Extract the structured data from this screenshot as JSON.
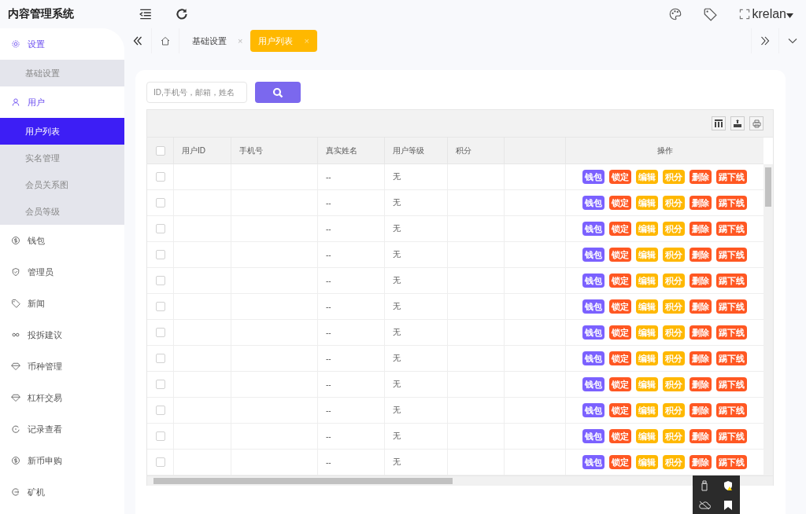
{
  "app": {
    "title": "内容管理系统",
    "user": "krelan"
  },
  "sidebar": {
    "items": [
      {
        "label": "设置",
        "expanded": true,
        "children": [
          {
            "label": "基础设置",
            "selected": false
          }
        ]
      },
      {
        "label": "用户",
        "expanded": true,
        "children": [
          {
            "label": "用户列表",
            "selected": true
          },
          {
            "label": "实名管理",
            "selected": false
          },
          {
            "label": "会员关系图",
            "selected": false
          },
          {
            "label": "会员等级",
            "selected": false
          }
        ]
      },
      {
        "label": "钱包",
        "expanded": false
      },
      {
        "label": "管理员",
        "expanded": false
      },
      {
        "label": "新闻",
        "expanded": false
      },
      {
        "label": "投拆建议",
        "expanded": false
      },
      {
        "label": "币种管理",
        "expanded": false
      },
      {
        "label": "杠杆交易",
        "expanded": false
      },
      {
        "label": "记录查看",
        "expanded": false
      },
      {
        "label": "新币申购",
        "expanded": false
      },
      {
        "label": "矿机",
        "expanded": false
      }
    ]
  },
  "tabs": [
    {
      "label": "基础设置",
      "close": "×",
      "selected": false
    },
    {
      "label": "用户列表",
      "close": "×",
      "selected": true
    }
  ],
  "search": {
    "placeholder": "ID,手机号，邮箱，姓名"
  },
  "table": {
    "select_all_checked": false,
    "columns": [
      "用户ID",
      "手机号",
      "真实姓名",
      "用户等级",
      "积分",
      "",
      "操作"
    ],
    "rows": [
      {
        "checked": false,
        "real_name": "--",
        "level": "无",
        "actions": [
          {
            "label": "钱包",
            "color": "#7b61ff"
          },
          {
            "label": "锁定",
            "color": "#ff5722"
          },
          {
            "label": "编辑",
            "color": "#ffb800"
          },
          {
            "label": "积分",
            "color": "#ffb800"
          },
          {
            "label": "删除",
            "color": "#ff5722"
          },
          {
            "label": "踢下线",
            "color": "#ff5722"
          }
        ]
      },
      {
        "checked": false,
        "real_name": "--",
        "level": "无",
        "actions": [
          {
            "label": "钱包",
            "color": "#7b61ff"
          },
          {
            "label": "锁定",
            "color": "#ff5722"
          },
          {
            "label": "编辑",
            "color": "#ffb800"
          },
          {
            "label": "积分",
            "color": "#ffb800"
          },
          {
            "label": "删除",
            "color": "#ff5722"
          },
          {
            "label": "踢下线",
            "color": "#ff5722"
          }
        ]
      },
      {
        "checked": false,
        "real_name": "--",
        "level": "无",
        "actions": [
          {
            "label": "钱包",
            "color": "#7b61ff"
          },
          {
            "label": "锁定",
            "color": "#ff5722"
          },
          {
            "label": "编辑",
            "color": "#ffb800"
          },
          {
            "label": "积分",
            "color": "#ffb800"
          },
          {
            "label": "删除",
            "color": "#ff5722"
          },
          {
            "label": "踢下线",
            "color": "#ff5722"
          }
        ]
      },
      {
        "checked": false,
        "real_name": "--",
        "level": "无",
        "actions": [
          {
            "label": "钱包",
            "color": "#7b61ff"
          },
          {
            "label": "锁定",
            "color": "#ff5722"
          },
          {
            "label": "编辑",
            "color": "#ffb800"
          },
          {
            "label": "积分",
            "color": "#ffb800"
          },
          {
            "label": "删除",
            "color": "#ff5722"
          },
          {
            "label": "踢下线",
            "color": "#ff5722"
          }
        ]
      },
      {
        "checked": false,
        "real_name": "--",
        "level": "无",
        "actions": [
          {
            "label": "钱包",
            "color": "#7b61ff"
          },
          {
            "label": "锁定",
            "color": "#ff5722"
          },
          {
            "label": "编辑",
            "color": "#ffb800"
          },
          {
            "label": "积分",
            "color": "#ffb800"
          },
          {
            "label": "删除",
            "color": "#ff5722"
          },
          {
            "label": "踢下线",
            "color": "#ff5722"
          }
        ]
      },
      {
        "checked": false,
        "real_name": "--",
        "level": "无",
        "actions": [
          {
            "label": "钱包",
            "color": "#7b61ff"
          },
          {
            "label": "锁定",
            "color": "#ff5722"
          },
          {
            "label": "编辑",
            "color": "#ffb800"
          },
          {
            "label": "积分",
            "color": "#ffb800"
          },
          {
            "label": "删除",
            "color": "#ff5722"
          },
          {
            "label": "踢下线",
            "color": "#ff5722"
          }
        ]
      },
      {
        "checked": false,
        "real_name": "--",
        "level": "无",
        "actions": [
          {
            "label": "钱包",
            "color": "#7b61ff"
          },
          {
            "label": "锁定",
            "color": "#ff5722"
          },
          {
            "label": "编辑",
            "color": "#ffb800"
          },
          {
            "label": "积分",
            "color": "#ffb800"
          },
          {
            "label": "删除",
            "color": "#ff5722"
          },
          {
            "label": "踢下线",
            "color": "#ff5722"
          }
        ]
      },
      {
        "checked": false,
        "real_name": "--",
        "level": "无",
        "actions": [
          {
            "label": "钱包",
            "color": "#7b61ff"
          },
          {
            "label": "锁定",
            "color": "#ff5722"
          },
          {
            "label": "编辑",
            "color": "#ffb800"
          },
          {
            "label": "积分",
            "color": "#ffb800"
          },
          {
            "label": "删除",
            "color": "#ff5722"
          },
          {
            "label": "踢下线",
            "color": "#ff5722"
          }
        ]
      },
      {
        "checked": false,
        "real_name": "--",
        "level": "无",
        "actions": [
          {
            "label": "钱包",
            "color": "#7b61ff"
          },
          {
            "label": "锁定",
            "color": "#ff5722"
          },
          {
            "label": "编辑",
            "color": "#ffb800"
          },
          {
            "label": "积分",
            "color": "#ffb800"
          },
          {
            "label": "删除",
            "color": "#ff5722"
          },
          {
            "label": "踢下线",
            "color": "#ff5722"
          }
        ]
      },
      {
        "checked": false,
        "real_name": "--",
        "level": "无",
        "actions": [
          {
            "label": "钱包",
            "color": "#7b61ff"
          },
          {
            "label": "锁定",
            "color": "#ff5722"
          },
          {
            "label": "编辑",
            "color": "#ffb800"
          },
          {
            "label": "积分",
            "color": "#ffb800"
          },
          {
            "label": "删除",
            "color": "#ff5722"
          },
          {
            "label": "踢下线",
            "color": "#ff5722"
          }
        ]
      },
      {
        "checked": false,
        "real_name": "--",
        "level": "无",
        "actions": [
          {
            "label": "钱包",
            "color": "#7b61ff"
          },
          {
            "label": "锁定",
            "color": "#ff5722"
          },
          {
            "label": "编辑",
            "color": "#ffb800"
          },
          {
            "label": "积分",
            "color": "#ffb800"
          },
          {
            "label": "删除",
            "color": "#ff5722"
          },
          {
            "label": "踢下线",
            "color": "#ff5722"
          }
        ]
      },
      {
        "checked": false,
        "real_name": "--",
        "level": "无",
        "actions": [
          {
            "label": "钱包",
            "color": "#7b61ff"
          },
          {
            "label": "锁定",
            "color": "#ff5722"
          },
          {
            "label": "编辑",
            "color": "#ffb800"
          },
          {
            "label": "积分",
            "color": "#ffb800"
          },
          {
            "label": "删除",
            "color": "#ff5722"
          },
          {
            "label": "踢下线",
            "color": "#ff5722"
          }
        ]
      }
    ]
  }
}
